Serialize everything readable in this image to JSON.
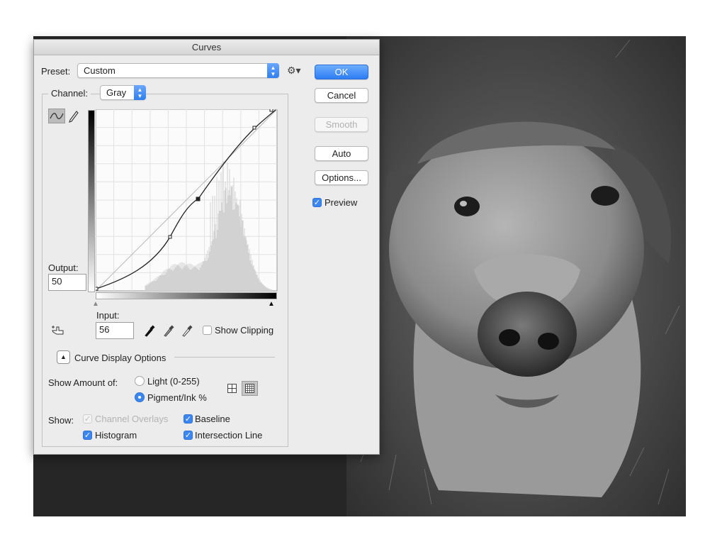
{
  "dialog": {
    "title": "Curves",
    "preset_label": "Preset:",
    "preset_value": "Custom",
    "channel_label": "Channel:",
    "channel_value": "Gray",
    "buttons": {
      "ok": "OK",
      "cancel": "Cancel",
      "smooth": "Smooth",
      "auto": "Auto",
      "options": "Options..."
    },
    "preview_label": "Preview",
    "preview_checked": true,
    "output_label": "Output:",
    "output_value": "50",
    "input_label": "Input:",
    "input_value": "56",
    "show_clipping_label": "Show Clipping",
    "show_clipping_checked": false,
    "curve_display_options_label": "Curve Display Options",
    "show_amount_label": "Show Amount of:",
    "light_option": "Light  (0-255)",
    "pigment_option": "Pigment/Ink %",
    "selected_amount": "Pigment/Ink %",
    "show_label": "Show:",
    "show_options": {
      "channel_overlays": "Channel Overlays",
      "baseline": "Baseline",
      "histogram": "Histogram",
      "intersection_line": "Intersection Line"
    },
    "show_checked": {
      "channel_overlays": true,
      "baseline": true,
      "histogram": true,
      "intersection_line": true
    }
  },
  "colors": {
    "accent": "#3b86f0",
    "dialog_bg": "#ececec",
    "workspace_bg": "#262626"
  },
  "icons": {
    "curve_tool": "curve-points-icon",
    "pencil_tool": "pencil-icon",
    "target_adjust": "hand-target-icon",
    "black_eyedropper": "black-eyedropper-icon",
    "gray_eyedropper": "gray-eyedropper-icon",
    "white_eyedropper": "white-eyedropper-icon",
    "preset_gear": "gear-icon",
    "grid_simple": "grid-4-icon",
    "grid_detailed": "grid-10-icon"
  }
}
